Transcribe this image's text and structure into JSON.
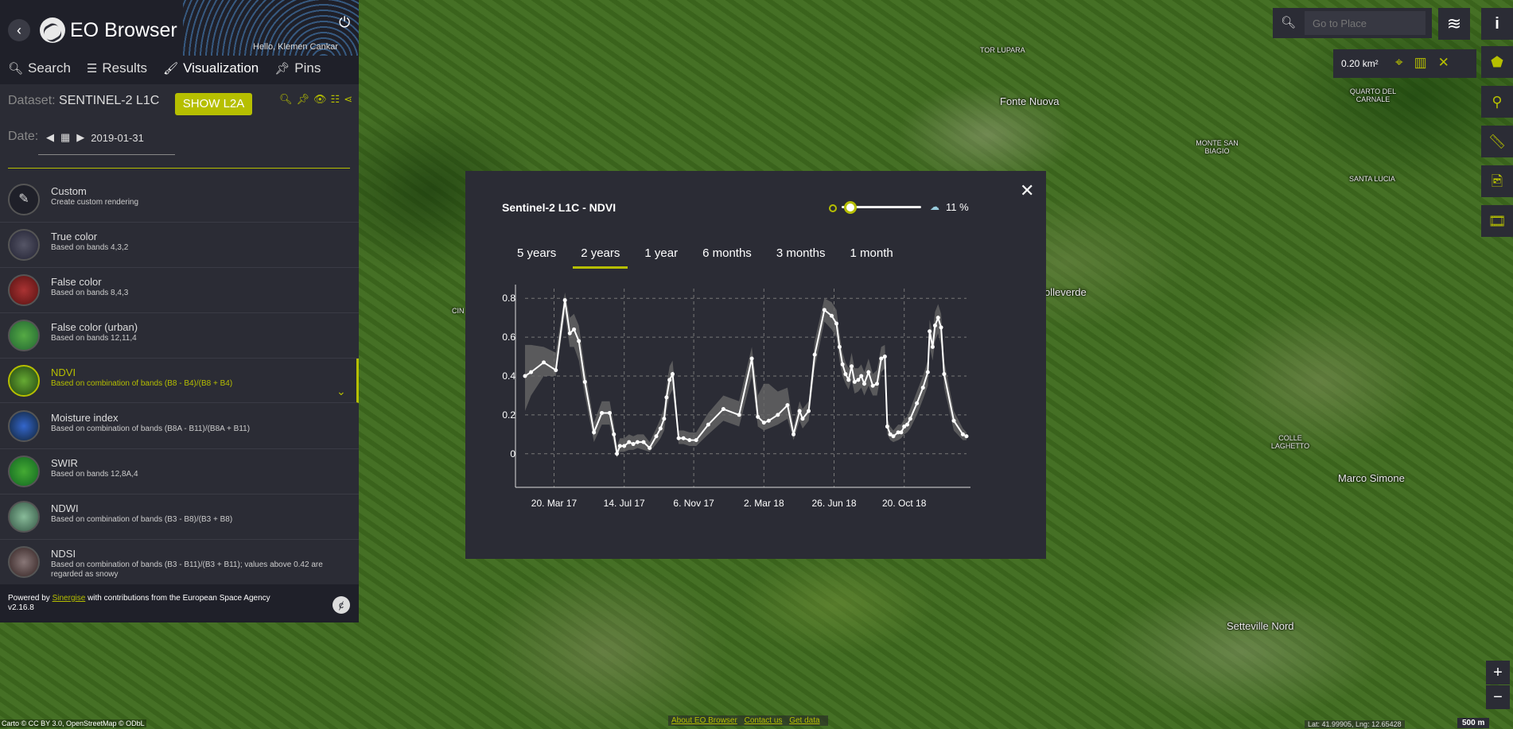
{
  "app": {
    "title": "EO Browser",
    "user_greeting": "Hello, Klemen Cankar"
  },
  "tabs": [
    {
      "label": "Search"
    },
    {
      "label": "Results"
    },
    {
      "label": "Visualization"
    },
    {
      "label": "Pins"
    }
  ],
  "dataset": {
    "label": "Dataset:",
    "value": "SENTINEL-2 L1C",
    "show_l2a": "SHOW L2A"
  },
  "date": {
    "label": "Date:",
    "value": "2019-01-31"
  },
  "layers": [
    {
      "name": "Custom",
      "desc": "Create custom rendering"
    },
    {
      "name": "True color",
      "desc": "Based on bands 4,3,2"
    },
    {
      "name": "False color",
      "desc": "Based on bands 8,4,3"
    },
    {
      "name": "False color (urban)",
      "desc": "Based on bands 12,11,4"
    },
    {
      "name": "NDVI",
      "desc": "Based on combination of bands (B8 - B4)/(B8 + B4)"
    },
    {
      "name": "Moisture index",
      "desc": "Based on combination of bands (B8A - B11)/(B8A + B11)"
    },
    {
      "name": "SWIR",
      "desc": "Based on bands 12,8A,4"
    },
    {
      "name": "NDWI",
      "desc": "Based on combination of bands (B3 - B8)/(B3 + B8)"
    },
    {
      "name": "NDSI",
      "desc": "Based on combination of bands (B3 - B11)/(B3 + B11); values above 0.42 are regarded as snowy"
    }
  ],
  "footer": {
    "powered_by": "Powered by",
    "link": "Sinergise",
    "rest": "with contributions from the European Space Agency",
    "version": "v2.16.8"
  },
  "modal": {
    "title": "Sentinel-2 L1C - NDVI",
    "cloud_coverage": "11 %",
    "cloud_slider_fraction": 0.11,
    "range_tabs": [
      "5 years",
      "2 years",
      "1 year",
      "6 months",
      "3 months",
      "1 month"
    ],
    "active_range": "2 years"
  },
  "chart_data": {
    "type": "line",
    "title": "",
    "xlabel": "",
    "ylabel": "",
    "ylim": [
      -0.05,
      0.85
    ],
    "yticks": [
      0,
      0.2,
      0.4,
      0.6,
      0.8
    ],
    "x_tick_labels": [
      "20. Mar 17",
      "14. Jul 17",
      "6. Nov 17",
      "2. Mar 18",
      "26. Jun 18",
      "20. Oct 18"
    ],
    "x_tick_dates": [
      "2017-03-20",
      "2017-07-14",
      "2017-11-06",
      "2018-03-02",
      "2018-06-26",
      "2018-10-20"
    ],
    "xlim": [
      "2017-01-31",
      "2019-01-31"
    ],
    "grid": true,
    "series": [
      {
        "x": [
          "2017-01-31",
          "2017-02-10",
          "2017-03-03",
          "2017-03-23",
          "2017-04-07",
          "2017-04-15",
          "2017-04-22",
          "2017-04-30",
          "2017-05-10",
          "2017-05-25",
          "2017-06-07",
          "2017-06-20",
          "2017-06-27",
          "2017-07-02",
          "2017-07-07",
          "2017-07-14",
          "2017-07-22",
          "2017-07-29",
          "2017-08-05",
          "2017-08-15",
          "2017-08-25",
          "2017-09-05",
          "2017-09-12",
          "2017-09-18",
          "2017-09-22",
          "2017-09-27",
          "2017-10-02",
          "2017-10-12",
          "2017-10-20",
          "2017-10-30",
          "2017-11-10",
          "2017-11-30",
          "2017-12-25",
          "2018-01-20",
          "2018-02-10",
          "2018-02-20",
          "2018-03-02",
          "2018-03-10",
          "2018-03-25",
          "2018-04-10",
          "2018-04-20",
          "2018-04-30",
          "2018-05-05",
          "2018-05-15",
          "2018-05-25",
          "2018-06-10",
          "2018-06-22",
          "2018-06-30",
          "2018-07-05",
          "2018-07-10",
          "2018-07-15",
          "2018-07-20",
          "2018-07-25",
          "2018-07-30",
          "2018-08-05",
          "2018-08-10",
          "2018-08-15",
          "2018-08-22",
          "2018-08-29",
          "2018-09-05",
          "2018-09-12",
          "2018-09-18",
          "2018-09-22",
          "2018-09-27",
          "2018-10-02",
          "2018-10-10",
          "2018-10-15",
          "2018-10-20",
          "2018-10-25",
          "2018-10-30",
          "2018-11-10",
          "2018-11-20",
          "2018-11-28",
          "2018-12-01",
          "2018-12-06",
          "2018-12-10",
          "2018-12-15",
          "2018-12-20",
          "2018-12-25",
          "2019-01-10",
          "2019-01-25",
          "2019-01-31"
        ],
        "y": [
          0.4,
          0.42,
          0.47,
          0.43,
          0.79,
          0.62,
          0.64,
          0.58,
          0.37,
          0.11,
          0.21,
          0.21,
          0.1,
          0.0,
          0.04,
          0.04,
          0.06,
          0.05,
          0.06,
          0.06,
          0.03,
          0.09,
          0.13,
          0.18,
          0.29,
          0.38,
          0.41,
          0.08,
          0.08,
          0.07,
          0.07,
          0.15,
          0.23,
          0.2,
          0.49,
          0.19,
          0.16,
          0.17,
          0.2,
          0.25,
          0.1,
          0.22,
          0.18,
          0.22,
          0.51,
          0.74,
          0.71,
          0.67,
          0.55,
          0.46,
          0.41,
          0.38,
          0.45,
          0.37,
          0.38,
          0.4,
          0.36,
          0.42,
          0.35,
          0.36,
          0.49,
          0.5,
          0.14,
          0.1,
          0.09,
          0.11,
          0.11,
          0.14,
          0.15,
          0.18,
          0.26,
          0.34,
          0.42,
          0.63,
          0.55,
          0.66,
          0.7,
          0.65,
          0.41,
          0.17,
          0.1,
          0.09
        ],
        "band_low": [
          0.22,
          0.3,
          0.4,
          0.4,
          0.72,
          0.55,
          0.55,
          0.48,
          0.3,
          0.06,
          0.15,
          0.15,
          0.05,
          -0.02,
          0.01,
          0.01,
          0.02,
          0.02,
          0.03,
          0.02,
          0.01,
          0.05,
          0.08,
          0.12,
          0.22,
          0.3,
          0.33,
          0.05,
          0.05,
          0.04,
          0.04,
          0.1,
          0.17,
          0.14,
          0.4,
          0.14,
          0.12,
          0.13,
          0.15,
          0.18,
          0.07,
          0.17,
          0.13,
          0.17,
          0.44,
          0.68,
          0.64,
          0.6,
          0.48,
          0.4,
          0.36,
          0.33,
          0.38,
          0.31,
          0.32,
          0.34,
          0.3,
          0.35,
          0.3,
          0.3,
          0.42,
          0.44,
          0.1,
          0.07,
          0.06,
          0.07,
          0.08,
          0.1,
          0.11,
          0.13,
          0.2,
          0.28,
          0.35,
          0.55,
          0.48,
          0.58,
          0.62,
          0.56,
          0.34,
          0.12,
          0.07,
          0.07
        ],
        "band_high": [
          0.56,
          0.56,
          0.55,
          0.52,
          0.83,
          0.7,
          0.72,
          0.66,
          0.44,
          0.16,
          0.27,
          0.27,
          0.15,
          0.04,
          0.08,
          0.08,
          0.1,
          0.09,
          0.1,
          0.1,
          0.06,
          0.13,
          0.18,
          0.24,
          0.35,
          0.45,
          0.48,
          0.12,
          0.12,
          0.11,
          0.11,
          0.21,
          0.3,
          0.27,
          0.55,
          0.3,
          0.36,
          0.36,
          0.32,
          0.34,
          0.14,
          0.27,
          0.23,
          0.27,
          0.58,
          0.8,
          0.78,
          0.74,
          0.62,
          0.52,
          0.47,
          0.44,
          0.52,
          0.44,
          0.44,
          0.46,
          0.42,
          0.49,
          0.41,
          0.43,
          0.55,
          0.56,
          0.18,
          0.14,
          0.12,
          0.15,
          0.15,
          0.18,
          0.19,
          0.23,
          0.32,
          0.4,
          0.48,
          0.69,
          0.62,
          0.73,
          0.77,
          0.72,
          0.48,
          0.22,
          0.13,
          0.11
        ]
      }
    ]
  },
  "search": {
    "placeholder": "Go to Place"
  },
  "area_tool": {
    "value": "0.20 km²"
  },
  "map_labels": [
    {
      "text": "TOR LUPARA",
      "size": "small"
    },
    {
      "text": "Fonte Nuova",
      "size": "normal"
    },
    {
      "text": "QUARTO DEL CARNALE",
      "size": "small"
    },
    {
      "text": "MONTE SAN BIAGIO",
      "size": "small"
    },
    {
      "text": "SANTA LUCIA",
      "size": "small"
    },
    {
      "text": "olleverde",
      "size": "normal"
    },
    {
      "text": "COLLE LAGHETTO",
      "size": "small"
    },
    {
      "text": "Marco Simone",
      "size": "normal"
    },
    {
      "text": "Setteville Nord",
      "size": "normal"
    },
    {
      "text": "CIN",
      "size": "small"
    }
  ],
  "attribution": "Carto © CC BY 3.0, OpenStreetMap © ODbL",
  "bottom_links": [
    "About EO Browser",
    "Contact us",
    "Get data"
  ],
  "coords": "Lat: 41.99905, Lng: 12.65428",
  "scale": "500 m"
}
